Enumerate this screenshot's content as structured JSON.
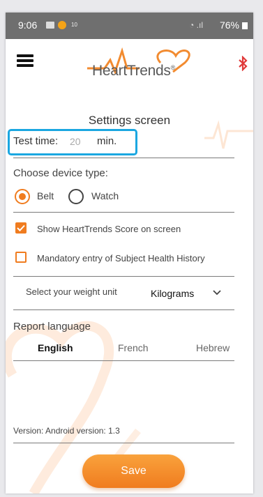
{
  "status_bar": {
    "time": "9:06",
    "small_icon_text": "10",
    "battery": "76%"
  },
  "header": {
    "logo_text": "HeartTrends",
    "logo_mark": "®"
  },
  "page": {
    "title": "Settings screen"
  },
  "test_time": {
    "label": "Test time:",
    "value": "20",
    "unit": "min."
  },
  "device_type": {
    "label": "Choose device type:",
    "options": [
      {
        "label": "Belt",
        "selected": true
      },
      {
        "label": "Watch",
        "selected": false
      }
    ]
  },
  "checkboxes": [
    {
      "label": "Show HeartTrends Score on screen",
      "checked": true
    },
    {
      "label": "Mandatory entry of Subject Health History",
      "checked": false
    }
  ],
  "weight": {
    "label": "Select your weight unit",
    "value": "Kilograms"
  },
  "report_language": {
    "label": "Report language",
    "options": [
      {
        "label": "English",
        "selected": true
      },
      {
        "label": "French",
        "selected": false
      },
      {
        "label": "Hebrew",
        "selected": false
      }
    ]
  },
  "version": {
    "text": "Version: Android version: 1.3"
  },
  "actions": {
    "save_label": "Save"
  },
  "colors": {
    "accent": "#f07c1f",
    "highlight_box": "#1ba7e1",
    "bluetooth": "#e03a3a",
    "logo_heart": "#f28b30"
  },
  "icons": {
    "menu": "hamburger-icon",
    "bluetooth": "bluetooth-icon",
    "chevron": "chevron-down-icon"
  }
}
